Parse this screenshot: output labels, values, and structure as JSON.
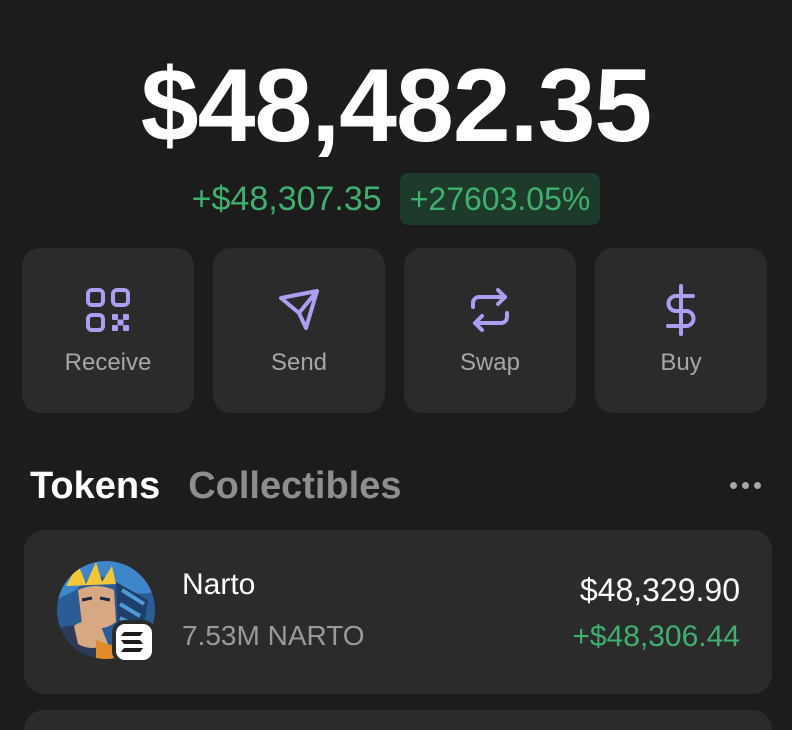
{
  "wallet": {
    "balance": "$48,482.35",
    "change_amount": "+$48,307.35",
    "change_percent": "+27603.05%"
  },
  "actions": [
    {
      "label": "Receive",
      "icon": "qr-code-icon"
    },
    {
      "label": "Send",
      "icon": "send-icon"
    },
    {
      "label": "Swap",
      "icon": "swap-icon"
    },
    {
      "label": "Buy",
      "icon": "dollar-icon"
    }
  ],
  "tabs": {
    "tokens": "Tokens",
    "collectibles": "Collectibles",
    "active": "Tokens"
  },
  "tokens": [
    {
      "name": "Narto",
      "amount": "7.53M NARTO",
      "value": "$48,329.90",
      "change": "+$48,306.44",
      "avatar": "token-avatar-anime",
      "chain_badge": "solana-icon"
    }
  ],
  "colors": {
    "background": "#1c1c1c",
    "card": "#2b2b2b",
    "accent": "#ab9ff2",
    "positive": "#3fb06e",
    "positive_bg": "#1d3a2a",
    "muted": "#a7a7a7"
  }
}
